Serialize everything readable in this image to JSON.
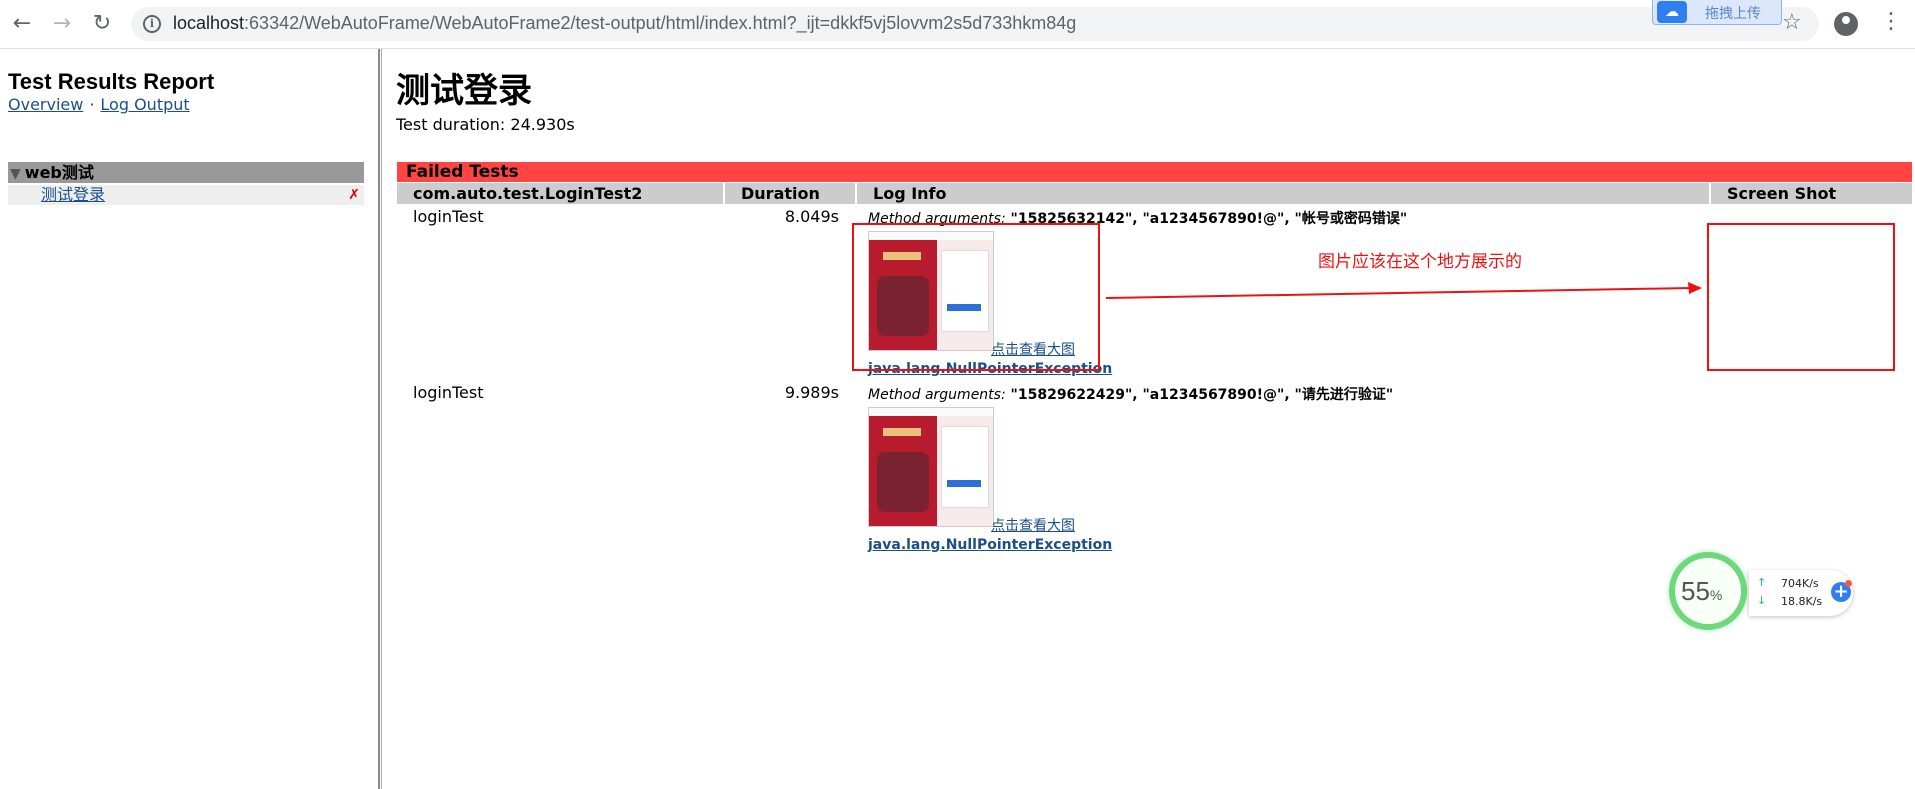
{
  "browser": {
    "url_host": "localhost",
    "url_rest": ":63342/WebAutoFrame/WebAutoFrame2/test-output/html/index.html?_ijt=dkkf5vj5lovvm2s5d733hkm84g",
    "upload_badge": "拖拽上传"
  },
  "sidebar": {
    "report_title": "Test Results Report",
    "overview_link": "Overview",
    "separator": "·",
    "log_output_link": "Log Output",
    "suite_name": "web测试",
    "tests": [
      {
        "label": "测试登录",
        "status_mark": "✗"
      }
    ]
  },
  "main": {
    "title": "测试登录",
    "duration": "Test duration: 24.930s",
    "failed_header": "Failed Tests",
    "columns": {
      "class": "com.auto.test.LoginTest2",
      "duration": "Duration",
      "log": "Log Info",
      "screenshot": "Screen Shot"
    },
    "rows": [
      {
        "name": "loginTest",
        "duration": "8.049s",
        "args_label": "Method arguments:",
        "args_value": " \"15825632142\", \"a1234567890!@\", \"帐号或密码错误\"",
        "thumb_link": "点击查看大图",
        "exception": "java.lang.NullPointerException"
      },
      {
        "name": "loginTest",
        "duration": "9.989s",
        "args_label": "Method arguments:",
        "args_value": " \"15829622429\", \"a1234567890!@\", \"请先进行验证\"",
        "thumb_link": "点击查看大图",
        "exception": "java.lang.NullPointerException"
      }
    ],
    "annotation": "图片应该在这个地方展示的"
  },
  "speed_widget": {
    "percent": "55",
    "percent_sign": "%",
    "upload_speed": "704K/s",
    "download_speed": "18.8K/s"
  },
  "colors": {
    "failed_bar": "#ff4444",
    "header_gray": "#cccccc",
    "annotation_red": "#ee1111"
  }
}
